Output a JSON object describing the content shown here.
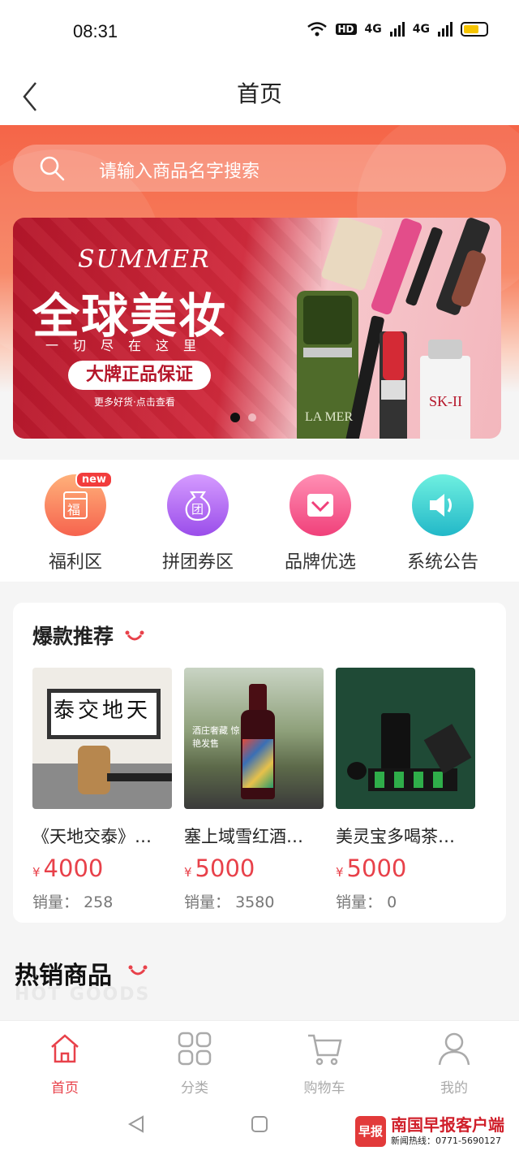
{
  "status": {
    "time": "08:31",
    "hd": "HD",
    "net1": "4G",
    "net2": "4G"
  },
  "nav": {
    "title": "首页"
  },
  "search": {
    "placeholder": "请输入商品名字搜索"
  },
  "banner": {
    "summer": "SUMMER",
    "title": "全球美妆",
    "subtitle": "一切尽在这里",
    "pill": "大牌正品保证",
    "more": "更多好货·点击查看"
  },
  "quick_menu": [
    {
      "label": "福利区",
      "icon": "gift-icon",
      "badge": "new",
      "glyph": "福"
    },
    {
      "label": "拼团券区",
      "icon": "group-coupon-icon",
      "glyph": "团"
    },
    {
      "label": "品牌优选",
      "icon": "diamond-icon"
    },
    {
      "label": "系统公告",
      "icon": "speaker-icon"
    }
  ],
  "recommend": {
    "title": "爆款推荐",
    "products": [
      {
        "name": "《天地交泰》…",
        "currency": "¥",
        "price": "4000",
        "sales_label": "销量：",
        "sales": "258",
        "calligraphy": "泰交地天"
      },
      {
        "name": "塞上域雪红酒…",
        "currency": "¥",
        "price": "5000",
        "sales_label": "销量：",
        "sales": "3580",
        "img_text": "酒庄奢藏 惊艳发售"
      },
      {
        "name": "美灵宝多喝茶…",
        "currency": "¥",
        "price": "5000",
        "sales_label": "销量：",
        "sales": "0"
      }
    ]
  },
  "hot": {
    "title": "热销商品",
    "subtitle": "HOT GOODS"
  },
  "tabs": [
    {
      "label": "首页",
      "active": true
    },
    {
      "label": "分类"
    },
    {
      "label": "购物车"
    },
    {
      "label": "我的"
    }
  ],
  "watermark": {
    "logo": "早报",
    "name": "南国早报客户端",
    "hotline": "新闻热线：0771-5690127"
  },
  "colors": {
    "accent": "#e8414a",
    "hero": "#f56548"
  }
}
